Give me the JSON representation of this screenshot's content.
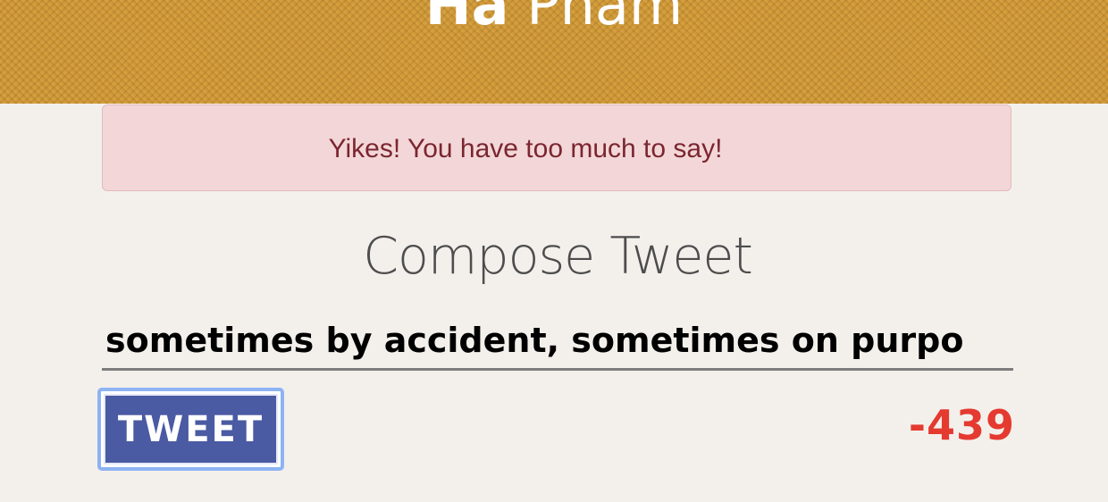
{
  "header": {
    "first_name": "Ha",
    "last_name": "Pham",
    "background_color": "#d49b38"
  },
  "alert": {
    "message": "Yikes! You have too much to say!",
    "background_color": "#f3d7d8",
    "text_color": "#7b2630"
  },
  "compose": {
    "title": "Compose Tweet",
    "input_value": "sometimes by accident, sometimes on purpo",
    "button_label": "TWEET",
    "char_counter": "-439",
    "counter_color": "#e53a30",
    "button_color": "#4a5aa3"
  }
}
